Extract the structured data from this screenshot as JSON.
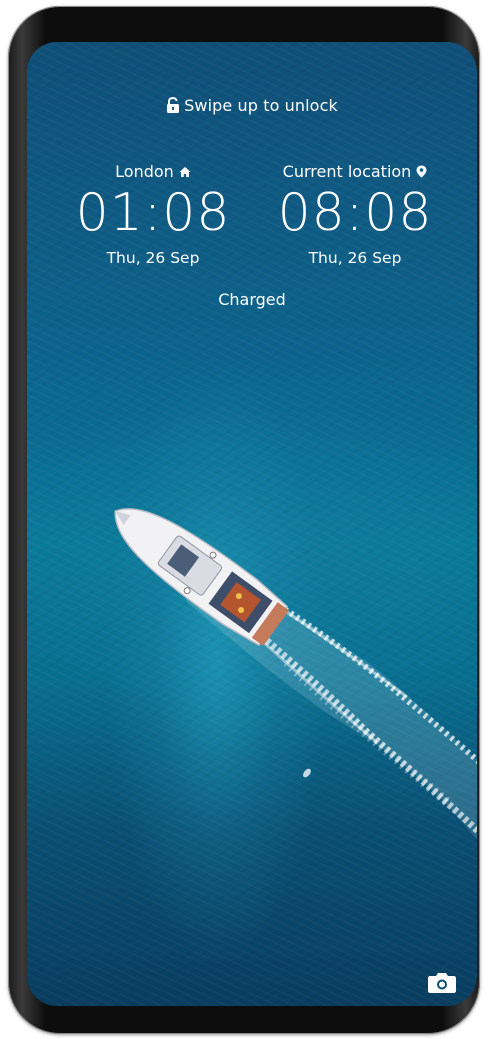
{
  "lockscreen": {
    "unlock_hint": "Swipe up to unlock",
    "lock_icon": "unlocked-padlock-icon",
    "battery_status": "Charged",
    "camera_icon": "camera-icon"
  },
  "clocks": [
    {
      "city": "London",
      "city_icon": "home-icon",
      "time": "01:08",
      "date": "Thu, 26 Sep"
    },
    {
      "city": "Current location",
      "city_icon": "location-pin-icon",
      "time": "08:08",
      "date": "Thu, 26 Sep"
    }
  ],
  "colors": {
    "sea_dark": "#0f4f78",
    "sea_light": "#0a7b9a",
    "text": "#ffffff",
    "bezel": "#0d0d0d"
  }
}
